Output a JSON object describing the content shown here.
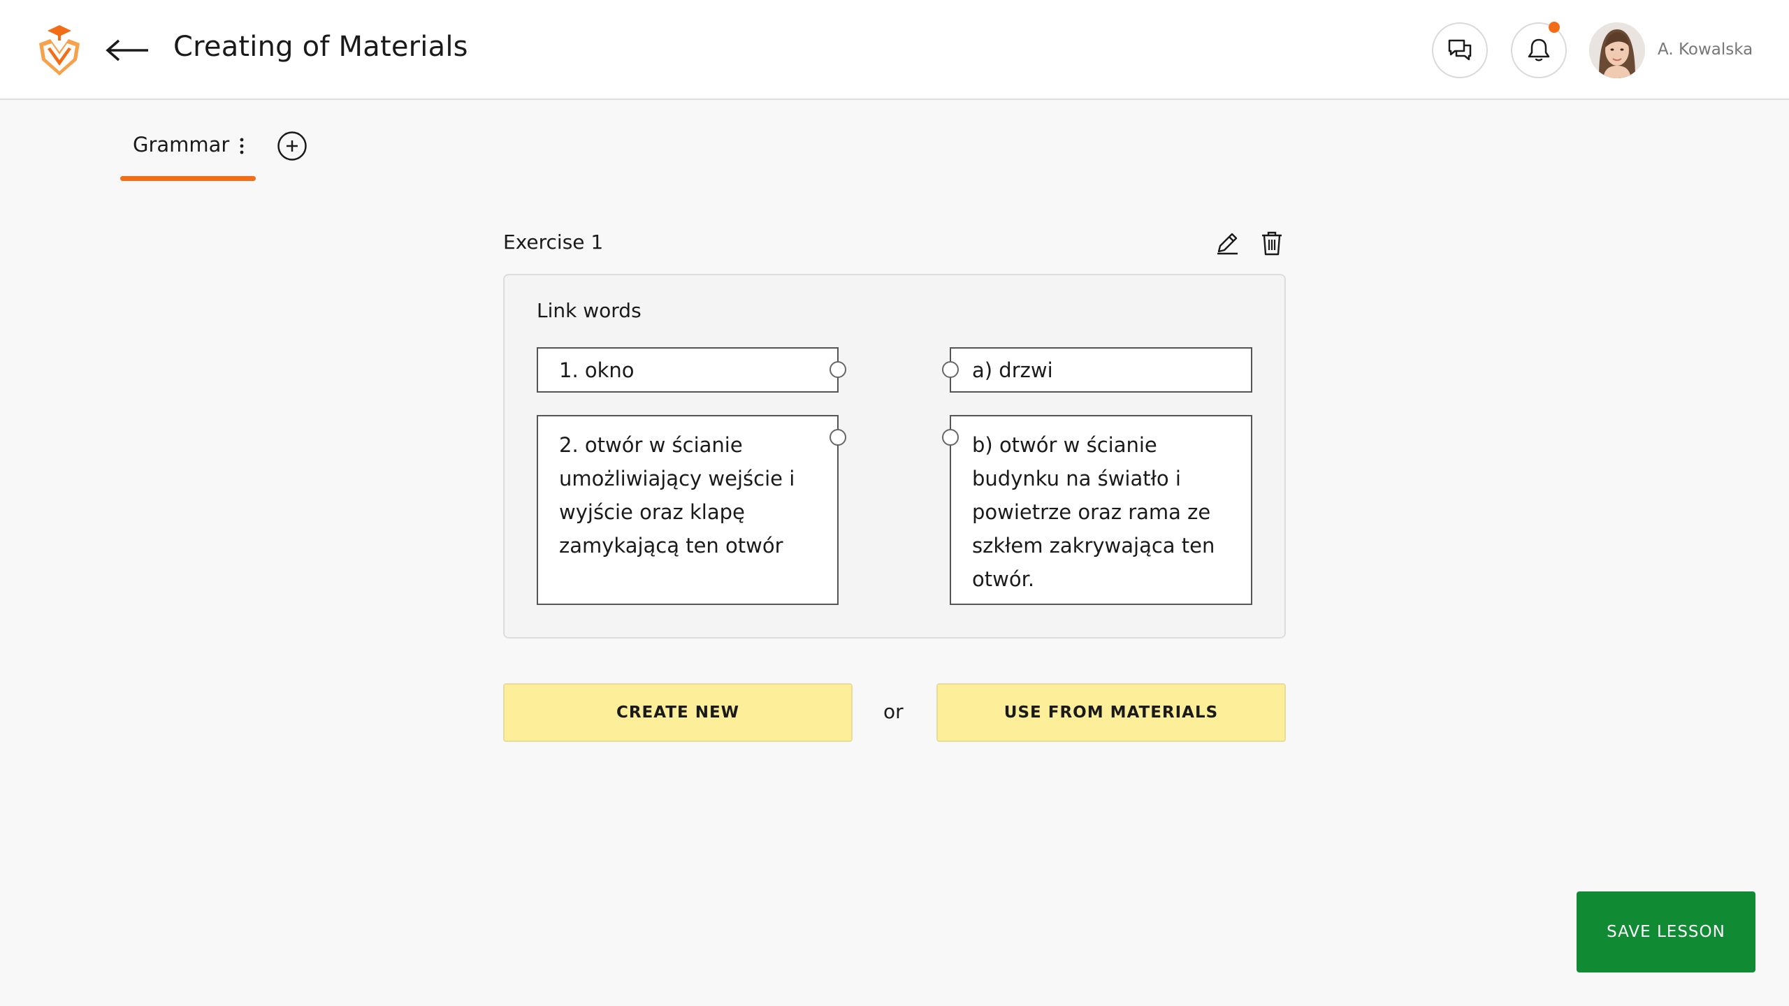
{
  "header": {
    "logo_icon": "graduation-cap-shield-logo",
    "back_icon": "arrow-left-icon",
    "title": "Creating of Materials",
    "chat_icon": "chat-icon",
    "bell_icon": "bell-icon",
    "has_notification": true,
    "user_name": "A. Kowalska"
  },
  "tabs": [
    {
      "label": "Grammar",
      "active": true
    }
  ],
  "exercise": {
    "title": "Exercise 1",
    "type_label": "Link words",
    "left_items": [
      "1. okno",
      "2. otwór w ścianie umożliwiający wejście i wyjście oraz klapę zamykającą ten otwór"
    ],
    "right_items": [
      "a) drzwi",
      "b) otwór w ścianie budynku na światło i powietrze oraz rama ze szkłem zakrywająca ten otwór."
    ]
  },
  "actions": {
    "create_new": "CREATE NEW",
    "or": "or",
    "use_from_materials": "USE FROM MATERIALS"
  },
  "save_label": "SAVE LESSON",
  "colors": {
    "accent": "#f36c16",
    "button_yellow": "#fdee9a",
    "save_green": "#118a34"
  }
}
